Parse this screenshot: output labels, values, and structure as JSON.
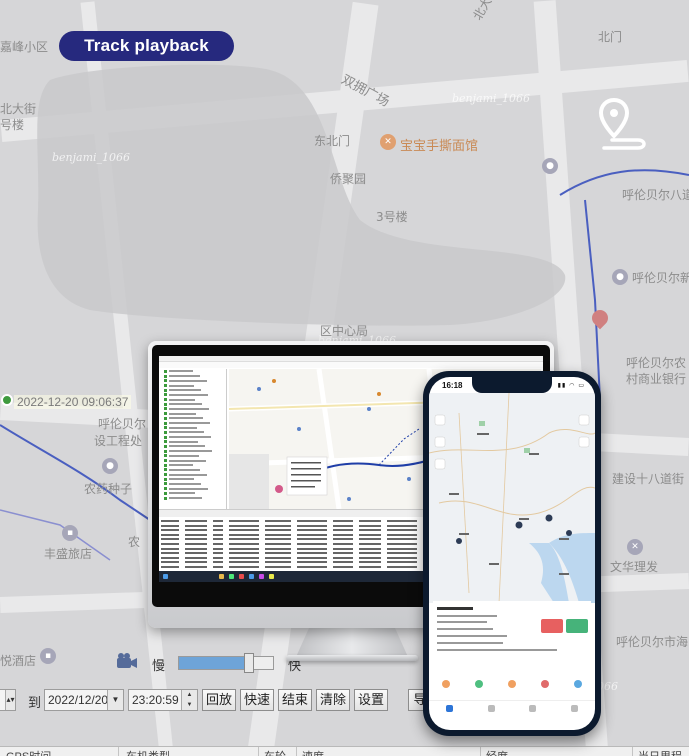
{
  "hero": {
    "title": "Track playback"
  },
  "watermarks": [
    "benjami_1066",
    "benjami_1066",
    "benjami_1066",
    "benjami_1066",
    "benjami_1066"
  ],
  "map": {
    "labels": {
      "l1": "嘉峰小区",
      "l2": "北大街",
      "l3": "号楼",
      "l4": "双拥广场",
      "l5": "东北门",
      "l6": "宝宝手撕面馆",
      "l7": "侨聚园",
      "l8": "3号楼",
      "l9": "北门",
      "l10": "区中心局",
      "l11": "呼伦贝尔",
      "l12": "设工程处",
      "l13": "农药种子",
      "l14": "丰盛旅店",
      "l15": "农",
      "l16": "悦酒店",
      "l17": "呼伦贝尔新",
      "l18": "呼伦贝尔农",
      "l19": "村商业银行",
      "l20": "建设十八道街",
      "l21": "文华理发",
      "l22": "呼伦贝尔市海",
      "l23": "呼伦贝尔八道",
      "l24": "北大"
    },
    "start_stamp": "2022-12-20 09:06:37"
  },
  "controls": {
    "slow_label": "慢",
    "fast_label": "快",
    "speed_fraction": 0.72,
    "to_label": "到",
    "end_date": "2022/12/20",
    "end_time": "23:20:59",
    "buttons": {
      "replay": "回放",
      "fast": "快速",
      "end": "结束",
      "clear": "清除",
      "settings": "设置",
      "export": "导"
    }
  },
  "table": {
    "headers": [
      "GPS时间",
      "车机类型",
      "车轮",
      "速度",
      "经度",
      "当日里程"
    ]
  },
  "phone": {
    "time": "16:18"
  },
  "colors": {
    "title_pill": "#26297e",
    "track_line": "#4a5fc0",
    "phone_frame": "#0c1a2e"
  }
}
